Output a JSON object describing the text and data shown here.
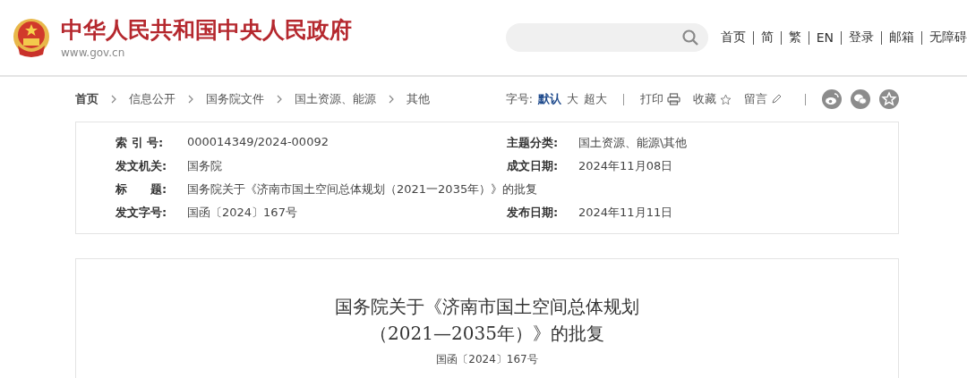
{
  "header": {
    "site_title": "中华人民共和国中央人民政府",
    "site_url": "www.gov.cn",
    "nav": [
      "首页",
      "简",
      "繁",
      "EN",
      "登录",
      "邮箱",
      "无障碍"
    ]
  },
  "breadcrumb": [
    "首页",
    "信息公开",
    "国务院文件",
    "国土资源、能源",
    "其他"
  ],
  "toolbar": {
    "font_label": "字号:",
    "font_sizes": [
      {
        "label": "默认",
        "selected": true
      },
      {
        "label": "大",
        "selected": false
      },
      {
        "label": "超大",
        "selected": false
      }
    ],
    "actions": [
      {
        "label": "打印",
        "kind": "print"
      },
      {
        "label": "收藏",
        "kind": "star"
      },
      {
        "label": "留言",
        "kind": "pencil"
      }
    ]
  },
  "meta": [
    [
      {
        "label": "索 引 号:",
        "value": "000014349/2024-00092"
      },
      {
        "label": "主题分类:",
        "value": "国土资源、能源\\其他"
      }
    ],
    [
      {
        "label": "发文机关:",
        "value": "国务院"
      },
      {
        "label": "成文日期:",
        "value": "2024年11月08日"
      }
    ],
    [
      {
        "label": "标　　题:",
        "value": "国务院关于《济南市国土空间总体规划（2021一2035年）》的批复"
      }
    ],
    [
      {
        "label": "发文字号:",
        "value": "国函〔2024〕167号"
      },
      {
        "label": "发布日期:",
        "value": "2024年11月11日"
      }
    ]
  ],
  "document": {
    "title_lines": [
      "国务院关于《济南市国土空间总体规划",
      "（2021—2035年）》的批复"
    ],
    "doc_number": "国函〔2024〕167号"
  }
}
